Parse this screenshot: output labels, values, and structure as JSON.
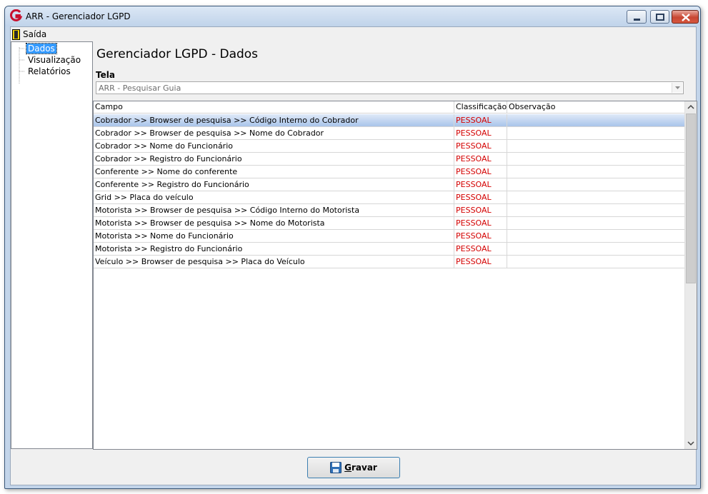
{
  "window": {
    "title": "ARR - Gerenciador LGPD"
  },
  "menu": {
    "exit_label": "Saída"
  },
  "tree": {
    "items": [
      {
        "label": "Dados",
        "selected": true
      },
      {
        "label": "Visualização",
        "selected": false
      },
      {
        "label": "Relatórios",
        "selected": false
      }
    ]
  },
  "main": {
    "title": "Gerenciador LGPD - Dados",
    "screen_label": "Tela",
    "screen_value": "ARR - Pesquisar Guia"
  },
  "grid": {
    "columns": [
      "Campo",
      "Classificação",
      "Observação"
    ],
    "rows": [
      {
        "campo": "Cobrador >> Browser de pesquisa >> Código Interno do Cobrador",
        "classificacao": "PESSOAL",
        "observacao": "",
        "selected": true
      },
      {
        "campo": "Cobrador >> Browser de pesquisa >> Nome do Cobrador",
        "classificacao": "PESSOAL",
        "observacao": ""
      },
      {
        "campo": "Cobrador >> Nome do Funcionário",
        "classificacao": "PESSOAL",
        "observacao": ""
      },
      {
        "campo": "Cobrador >> Registro do Funcionário",
        "classificacao": "PESSOAL",
        "observacao": ""
      },
      {
        "campo": "Conferente >> Nome do conferente",
        "classificacao": "PESSOAL",
        "observacao": ""
      },
      {
        "campo": "Conferente >> Registro do Funcionário",
        "classificacao": "PESSOAL",
        "observacao": ""
      },
      {
        "campo": "Grid >> Placa do veículo",
        "classificacao": "PESSOAL",
        "observacao": ""
      },
      {
        "campo": "Motorista >> Browser de pesquisa >> Código Interno do Motorista",
        "classificacao": "PESSOAL",
        "observacao": ""
      },
      {
        "campo": "Motorista >> Browser de pesquisa >> Nome do Motorista",
        "classificacao": "PESSOAL",
        "observacao": ""
      },
      {
        "campo": "Motorista >> Nome do Funcionário",
        "classificacao": "PESSOAL",
        "observacao": ""
      },
      {
        "campo": "Motorista >> Registro do Funcionário",
        "classificacao": "PESSOAL",
        "observacao": ""
      },
      {
        "campo": "Veículo >> Browser de pesquisa >> Placa do Veículo",
        "classificacao": "PESSOAL",
        "observacao": ""
      }
    ]
  },
  "footer": {
    "save_label_first": "G",
    "save_label_rest": "ravar"
  },
  "colors": {
    "classification_text": "#d40000",
    "selection": "#3399ff",
    "row_highlight": "#a9c4ea"
  },
  "icons": {
    "app": "app-logo-icon",
    "exit": "exit-door-icon",
    "save": "floppy-disk-icon"
  }
}
